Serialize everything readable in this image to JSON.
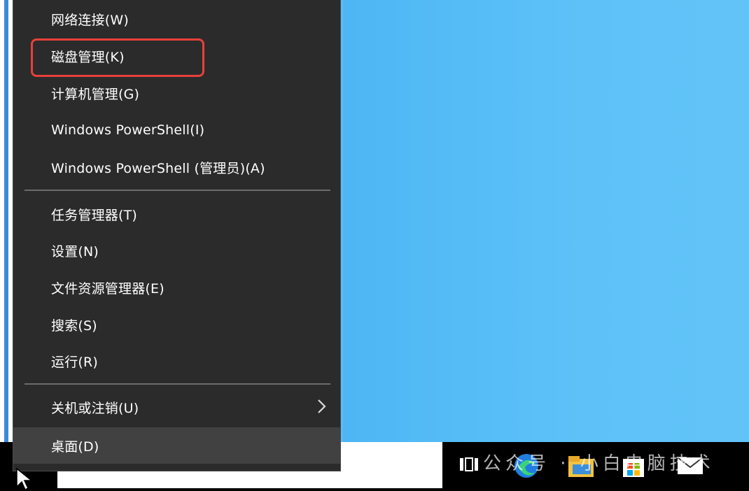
{
  "menu": {
    "items": [
      {
        "label": "网络连接(W)"
      },
      {
        "label": "磁盘管理(K)"
      },
      {
        "label": "计算机管理(G)"
      },
      {
        "label": "Windows PowerShell(I)"
      },
      {
        "label": "Windows PowerShell (管理员)(A)"
      },
      {
        "label": "任务管理器(T)"
      },
      {
        "label": "设置(N)"
      },
      {
        "label": "文件资源管理器(E)"
      },
      {
        "label": "搜索(S)"
      },
      {
        "label": "运行(R)"
      },
      {
        "label": "关机或注销(U)"
      },
      {
        "label": "桌面(D)"
      }
    ],
    "highlighted_item": "磁盘管理(K)",
    "highlight_color": "#e8403a"
  },
  "watermark": {
    "text": "公众号 · 小白电脑技术"
  },
  "colors": {
    "desktop": "#58bdf6",
    "menu_bg": "#2b2b2b",
    "hover_bg": "#414141"
  }
}
